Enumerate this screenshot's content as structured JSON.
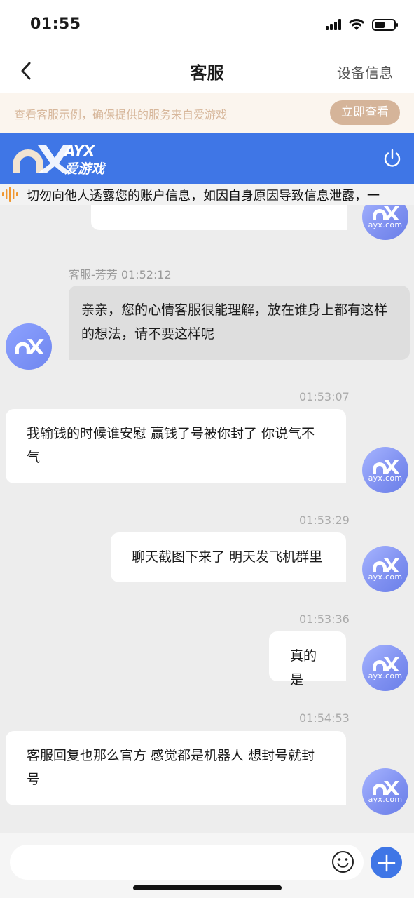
{
  "status_bar": {
    "time": "01:55"
  },
  "nav": {
    "title": "客服",
    "right_label": "设备信息"
  },
  "notice": {
    "text": "查看客服示例，确保提供的服务来自爱游戏",
    "button_label": "立即查看"
  },
  "brand": {
    "name_en": "AYX",
    "name_cn": "爱游戏",
    "accent_color": "#3f76e6"
  },
  "marquee": {
    "text": "切勿向他人透露您的账户信息，如因自身原因导致信息泄露，一"
  },
  "avatar_caption": "ayx.com",
  "messages": [
    {
      "type": "agent",
      "sender": "客服-芳芳",
      "time": "01:52:12",
      "text": "亲亲，您的心情客服很能理解，放在谁身上都有这样的想法，请不要这样呢"
    },
    {
      "type": "user",
      "time": "01:53:07",
      "text": "我输钱的时候谁安慰 赢钱了号被你封了 你说气不气"
    },
    {
      "type": "user",
      "time": "01:53:29",
      "text": "聊天截图下来了 明天发飞机群里"
    },
    {
      "type": "user",
      "time": "01:53:36",
      "text": "真的是"
    },
    {
      "type": "user",
      "time": "01:54:53",
      "text": "客服回复也那么官方 感觉都是机器人 想封号就封号"
    }
  ],
  "input": {
    "placeholder": ""
  },
  "icons": [
    "back-arrow-icon",
    "power-icon",
    "sound-wave-icon",
    "emoji-icon",
    "plus-icon",
    "signal-icon",
    "wifi-icon",
    "battery-icon"
  ]
}
